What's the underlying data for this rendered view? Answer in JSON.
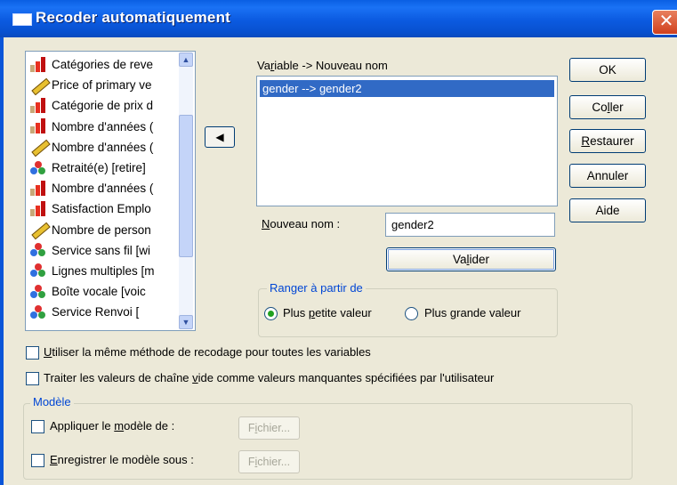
{
  "window": {
    "title": "Recoder automatiquement",
    "close_symbol": "✕"
  },
  "variables": [
    {
      "label": "Catégories de reve",
      "icon": "scale-bar-icon"
    },
    {
      "label": "Price of primary ve",
      "icon": "ruler-icon"
    },
    {
      "label": "Catégorie de prix d",
      "icon": "scale-bar-icon"
    },
    {
      "label": "Nombre d'années (",
      "icon": "scale-bar-icon"
    },
    {
      "label": "Nombre d'années (",
      "icon": "ruler-icon"
    },
    {
      "label": "Retraité(e) [retire]",
      "icon": "nominal-icon"
    },
    {
      "label": "Nombre d'années (",
      "icon": "scale-bar-icon"
    },
    {
      "label": "Satisfaction Emplo",
      "icon": "scale-bar-icon"
    },
    {
      "label": "Nombre de person",
      "icon": "ruler-icon"
    },
    {
      "label": "Service sans fil [wi",
      "icon": "nominal-icon"
    },
    {
      "label": "Lignes multiples [m",
      "icon": "nominal-icon"
    },
    {
      "label": "Boîte vocale [voic",
      "icon": "nominal-icon"
    },
    {
      "label": "Service Renvoi [",
      "icon": "nominal-icon"
    }
  ],
  "scroll": {
    "up": "▲",
    "down": "▼"
  },
  "move_button": {
    "symbol": "◀"
  },
  "mapping": {
    "header_pre": "Va",
    "header_ul": "r",
    "header_post": "iable -> Nouveau nom",
    "items": [
      "gender --> gender2"
    ]
  },
  "new_name": {
    "label_pre": "",
    "label_ul": "N",
    "label_post": "ouveau nom :",
    "value": "gender2"
  },
  "validate_button": {
    "pre": "Va",
    "ul": "l",
    "post": "ider"
  },
  "order_group": {
    "legend": "Ranger à partir de",
    "opt_low": {
      "pre": "Plus ",
      "ul": "p",
      "post": "etite valeur"
    },
    "opt_high": {
      "pre": "Plus ",
      "ul": "g",
      "post": "rande valeur"
    }
  },
  "options": {
    "same_method": {
      "pre": "",
      "ul": "U",
      "post": "tiliser la même méthode de recodage pour toutes les variables"
    },
    "blank_strings": {
      "pre": "Traiter les valeurs de chaîne ",
      "ul": "v",
      "post": "ide comme valeurs manquantes spécifiées par l'utilisateur"
    }
  },
  "template_group": {
    "legend": "Modèle",
    "apply": {
      "pre": "Appliquer le ",
      "ul": "m",
      "post": "odèle de :"
    },
    "save": {
      "pre": "",
      "ul": "E",
      "post": "nregistrer le modèle sous :"
    },
    "file_btn_1": {
      "pre": "F",
      "ul": "i",
      "post": "chier..."
    },
    "file_btn_2": {
      "pre": "F",
      "ul": "i",
      "post": "chier..."
    }
  },
  "buttons": {
    "ok": "OK",
    "paste": {
      "pre": "Co",
      "ul": "l",
      "post": "ler"
    },
    "reset": {
      "pre": "",
      "ul": "R",
      "post": "estaurer"
    },
    "cancel": "Annuler",
    "help": "Aide"
  }
}
